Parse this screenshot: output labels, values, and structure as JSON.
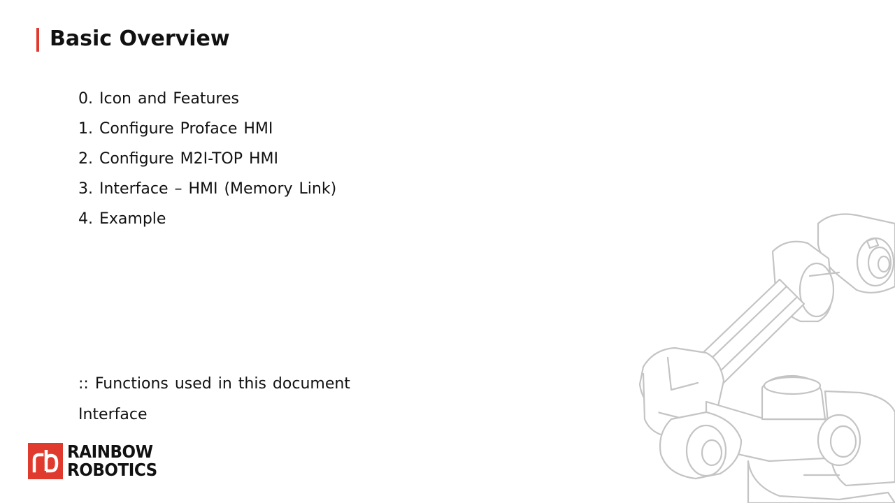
{
  "slide": {
    "title": "Basic Overview",
    "toc": [
      "0. Icon and Features",
      "1. Configure Proface HMI",
      "2. Configure M2I-TOP HMI",
      "3. Interface – HMI (Memory Link)",
      "4. Example"
    ],
    "functions_label": ":: Functions used in this document",
    "functions_value": "Interface"
  },
  "logo": {
    "line1": "RAINBOW",
    "line2": "ROBOTICS",
    "color": "#e03a2e"
  },
  "colors": {
    "accent": "#e03a2e",
    "text": "#111111",
    "robot_line": "#c4c4c4"
  }
}
